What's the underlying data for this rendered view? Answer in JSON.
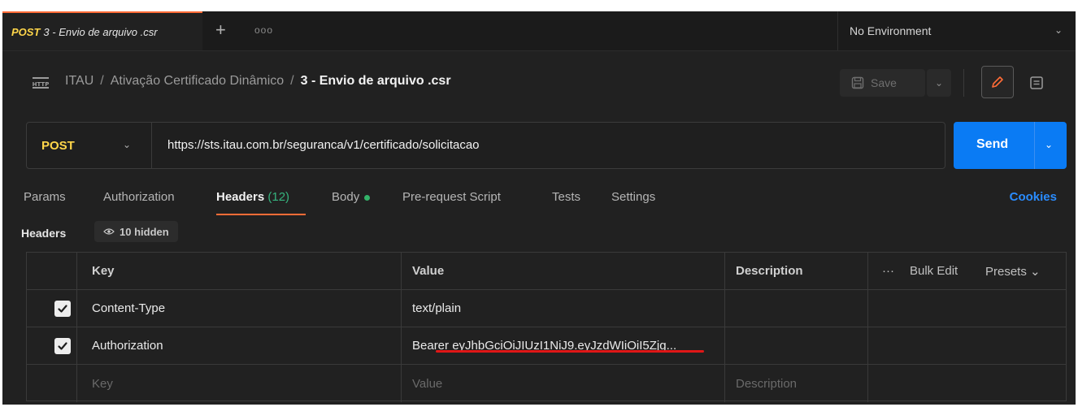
{
  "tab": {
    "method": "POST",
    "title": "3 - Envio de arquivo .csr",
    "more": "ooo"
  },
  "environment": {
    "label": "No Environment"
  },
  "breadcrumb": {
    "collection": "ITAU",
    "folder": "Ativação Certificado Dinâmico",
    "current": "3 - Envio de arquivo .csr"
  },
  "toolbar": {
    "save_label": "Save"
  },
  "request": {
    "method": "POST",
    "url": "https://sts.itau.com.br/seguranca/v1/certificado/solicitacao",
    "send_label": "Send"
  },
  "request_tabs": {
    "params": "Params",
    "authorization": "Authorization",
    "headers": "Headers",
    "headers_count": "(12)",
    "body": "Body",
    "prerequest": "Pre-request Script",
    "tests": "Tests",
    "settings": "Settings",
    "cookies": "Cookies"
  },
  "headers_section": {
    "label": "Headers",
    "hidden": "10 hidden"
  },
  "table": {
    "columns": {
      "key": "Key",
      "value": "Value",
      "description": "Description",
      "more": "···",
      "bulk_edit": "Bulk Edit",
      "presets": "Presets ⌄"
    },
    "rows": [
      {
        "checked": true,
        "key": "Content-Type",
        "value": "text/plain",
        "description": ""
      },
      {
        "checked": true,
        "key": "Authorization",
        "value_prefix": "Bearer",
        "value": "eyJhbGciOiJIUzI1NiJ9.eyJzdWIiOiI5Zjg...",
        "description": ""
      }
    ],
    "placeholder": {
      "key": "Key",
      "value": "Value",
      "description": "Description"
    }
  },
  "colors": {
    "accent": "#ff6c37",
    "send": "#0a7bf4",
    "method": "#ffd64a",
    "count": "#36b37e",
    "link": "#2a8cff",
    "annotation": "#e01717"
  }
}
